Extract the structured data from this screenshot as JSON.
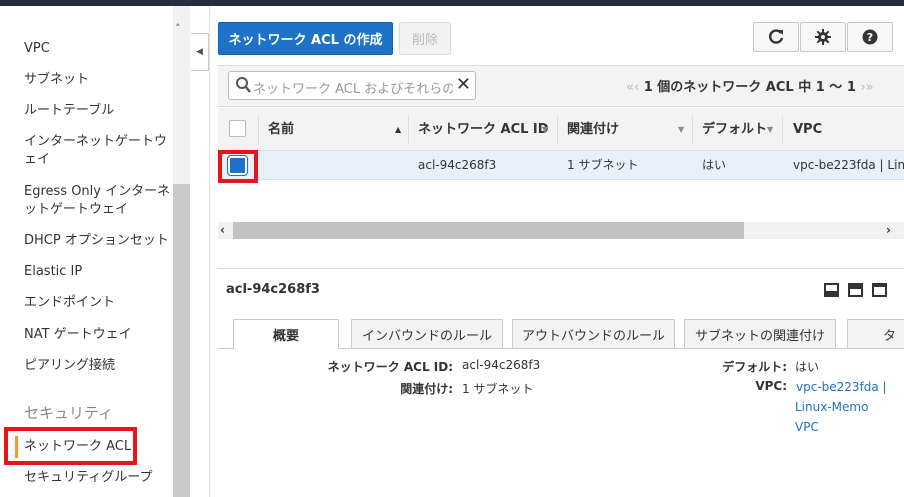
{
  "sidebar": {
    "items": [
      {
        "label": "VPC"
      },
      {
        "label": "サブネット"
      },
      {
        "label": "ルートテーブル"
      },
      {
        "label": "インターネットゲートウェイ"
      },
      {
        "label": "Egress Only インターネットゲートウェイ"
      },
      {
        "label": "DHCP オプションセット"
      },
      {
        "label": "Elastic IP"
      },
      {
        "label": "エンドポイント"
      },
      {
        "label": "NAT ゲートウェイ"
      },
      {
        "label": "ピアリング接続"
      }
    ],
    "section_security": "セキュリティ",
    "security_items": [
      {
        "label": "ネットワーク ACL"
      },
      {
        "label": "セキュリティグループ"
      }
    ]
  },
  "toolbar": {
    "create_label": "ネットワーク ACL の作成",
    "delete_label": "削除",
    "icons": [
      "refresh-icon",
      "gear-icon",
      "help-icon"
    ]
  },
  "filter": {
    "search_placeholder": "ネットワーク ACL およびそれらの",
    "pager_text": "1 個のネットワーク ACL 中 1 〜 1"
  },
  "table": {
    "columns": [
      "名前",
      "ネットワーク ACL ID",
      "関連付け",
      "デフォルト",
      "VPC"
    ],
    "rows": [
      {
        "name": "",
        "acl_id": "acl-94c268f3",
        "association": "1 サブネット",
        "default": "はい",
        "vpc": "vpc-be223fda | Lin"
      }
    ]
  },
  "detail": {
    "title": "acl-94c268f3",
    "tabs": [
      "概要",
      "インバウンドのルール",
      "アウトバウンドのルール",
      "サブネットの関連付け",
      "タ"
    ],
    "fields": {
      "acl_id_label": "ネットワーク ACL ID:",
      "acl_id_value": "acl-94c268f3",
      "association_label": "関連付け:",
      "association_value": "1 サブネット",
      "default_label": "デフォルト:",
      "default_value": "はい",
      "vpc_label": "VPC:",
      "vpc_value_1": "vpc-be223fda |",
      "vpc_value_2": "Linux-Memo",
      "vpc_value_3": "VPC"
    }
  },
  "colors": {
    "primary": "#1e72c8",
    "highlight": "#e8141a",
    "active_marker": "#f59a23"
  }
}
